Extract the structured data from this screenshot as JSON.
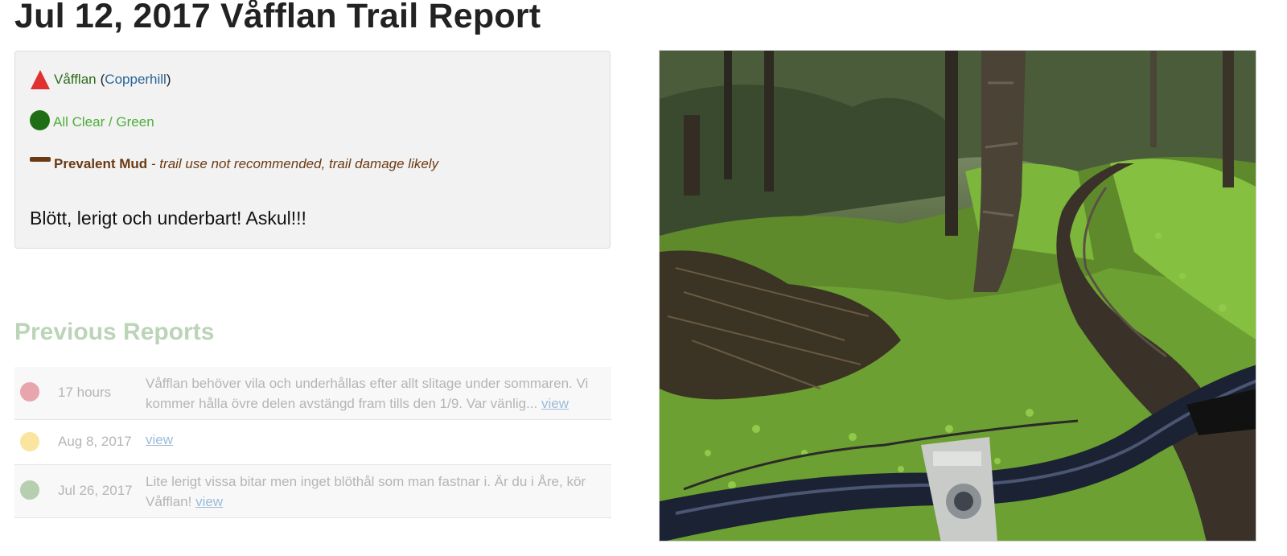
{
  "report": {
    "title": "Jul 12, 2017 Våfflan Trail Report",
    "trail_name": "Våfflan",
    "location_open": "(",
    "location_name": "Copperhill",
    "location_close": ")",
    "status_label": "All Clear / Green",
    "condition_label": "Prevalent Mud",
    "condition_desc": " - trail use not recommended, trail damage likely",
    "comment": "Blött, lerigt och underbart! Askul!!!",
    "icons": {
      "difficulty": "red-triangle-icon",
      "status": "green-circle-icon",
      "condition": "brown-bar-icon"
    },
    "colors": {
      "difficulty": "#e03030",
      "status": "#1f6e16",
      "condition": "#6b3a12"
    }
  },
  "previous": {
    "heading": "Previous Reports",
    "items": [
      {
        "date": "17 hours",
        "text": "Våfflan behöver vila och underhållas efter allt slitage under sommaren. Vi kommer hålla övre delen avstängd fram tills den 1/9. Var vänlig...",
        "link": "view",
        "dot_color": "#e9a5ac"
      },
      {
        "date": "Aug 8, 2017",
        "text": "",
        "link": "view",
        "dot_color": "#fbe3a0"
      },
      {
        "date": "Jul 26, 2017",
        "text": "Lite lerigt vissa bitar men inget blöthål som man fastnar i. Är du i Åre, kör Våfflan!",
        "link": "view",
        "dot_color": "#b5cfb0"
      }
    ]
  }
}
